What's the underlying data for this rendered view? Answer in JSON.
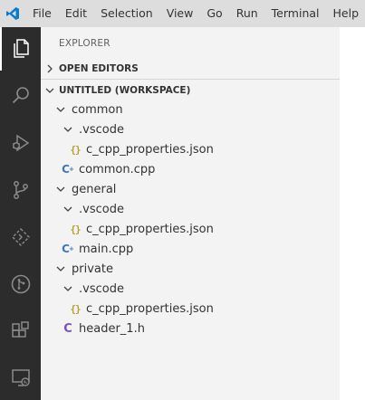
{
  "menu": [
    "File",
    "Edit",
    "Selection",
    "View",
    "Go",
    "Run",
    "Terminal",
    "Help"
  ],
  "explorer": {
    "title": "EXPLORER",
    "open_editors": "OPEN EDITORS",
    "workspace": "UNTITLED (WORKSPACE)"
  },
  "tree": {
    "common": "common",
    "common_vscode": ".vscode",
    "common_props": "c_cpp_properties.json",
    "common_cpp": "common.cpp",
    "general": "general",
    "general_vscode": ".vscode",
    "general_props": "c_cpp_properties.json",
    "main_cpp": "main.cpp",
    "private": "private",
    "private_vscode": ".vscode",
    "private_props": "c_cpp_properties.json",
    "header_h": "header_1.h"
  },
  "icons": {
    "json": "{}",
    "cpp": "C",
    "h": "C"
  },
  "colors": {
    "accent": "#007acc",
    "activitybar": "#2c2c2c",
    "sidebar": "#f3f3f3",
    "titlebar": "#dddddd"
  }
}
